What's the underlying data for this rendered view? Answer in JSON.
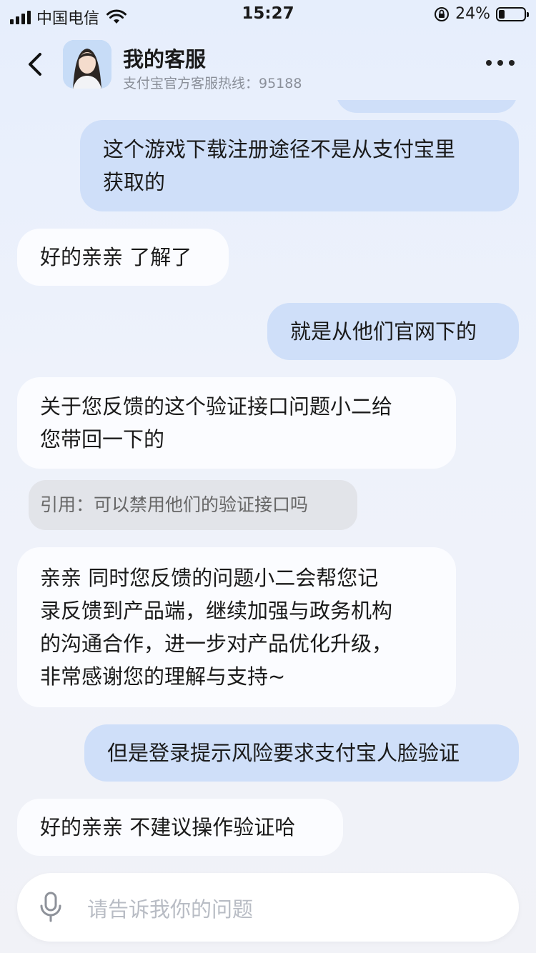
{
  "status_bar": {
    "carrier": "中国电信",
    "time": "15:27",
    "battery_percent": "24%",
    "battery_level": 0.24
  },
  "header": {
    "back_icon": "chevron-left-icon",
    "title": "我的客服",
    "subtitle": "支付宝官方客服热线：95188",
    "more_icon": "more-dots-icon"
  },
  "messages": [
    {
      "from": "user",
      "lines": [
        "这个游戏下载注册途径不是从支付宝里",
        "获取的"
      ]
    },
    {
      "from": "agent",
      "lines": [
        "好的亲亲 了解了"
      ]
    },
    {
      "from": "user",
      "lines": [
        "就是从他们官网下的"
      ]
    },
    {
      "from": "agent",
      "lines": [
        "关于您反馈的这个验证接口问题小二给",
        "您带回一下的"
      ]
    },
    {
      "from": "quote",
      "lines": [
        "引用：可以禁用他们的验证接口吗"
      ]
    },
    {
      "from": "agent",
      "lines": [
        "亲亲 同时您反馈的问题小二会帮您记",
        "录反馈到产品端，继续加强与政务机构",
        "的沟通合作，进一步对产品优化升级，",
        "非常感谢您的理解与支持~"
      ]
    },
    {
      "from": "user",
      "lines": [
        "但是登录提示风险要求支付宝人脸验证"
      ]
    },
    {
      "from": "agent",
      "lines": [
        "好的亲亲 不建议操作验证哈"
      ]
    }
  ],
  "input": {
    "placeholder": "请告诉我你的问题",
    "mic_icon": "microphone-icon"
  },
  "colors": {
    "user_bubble": "#cfdff9",
    "agent_bubble": "#fbfcff",
    "quote_bubble": "#e2e4e9",
    "background": "#e6eefc"
  }
}
